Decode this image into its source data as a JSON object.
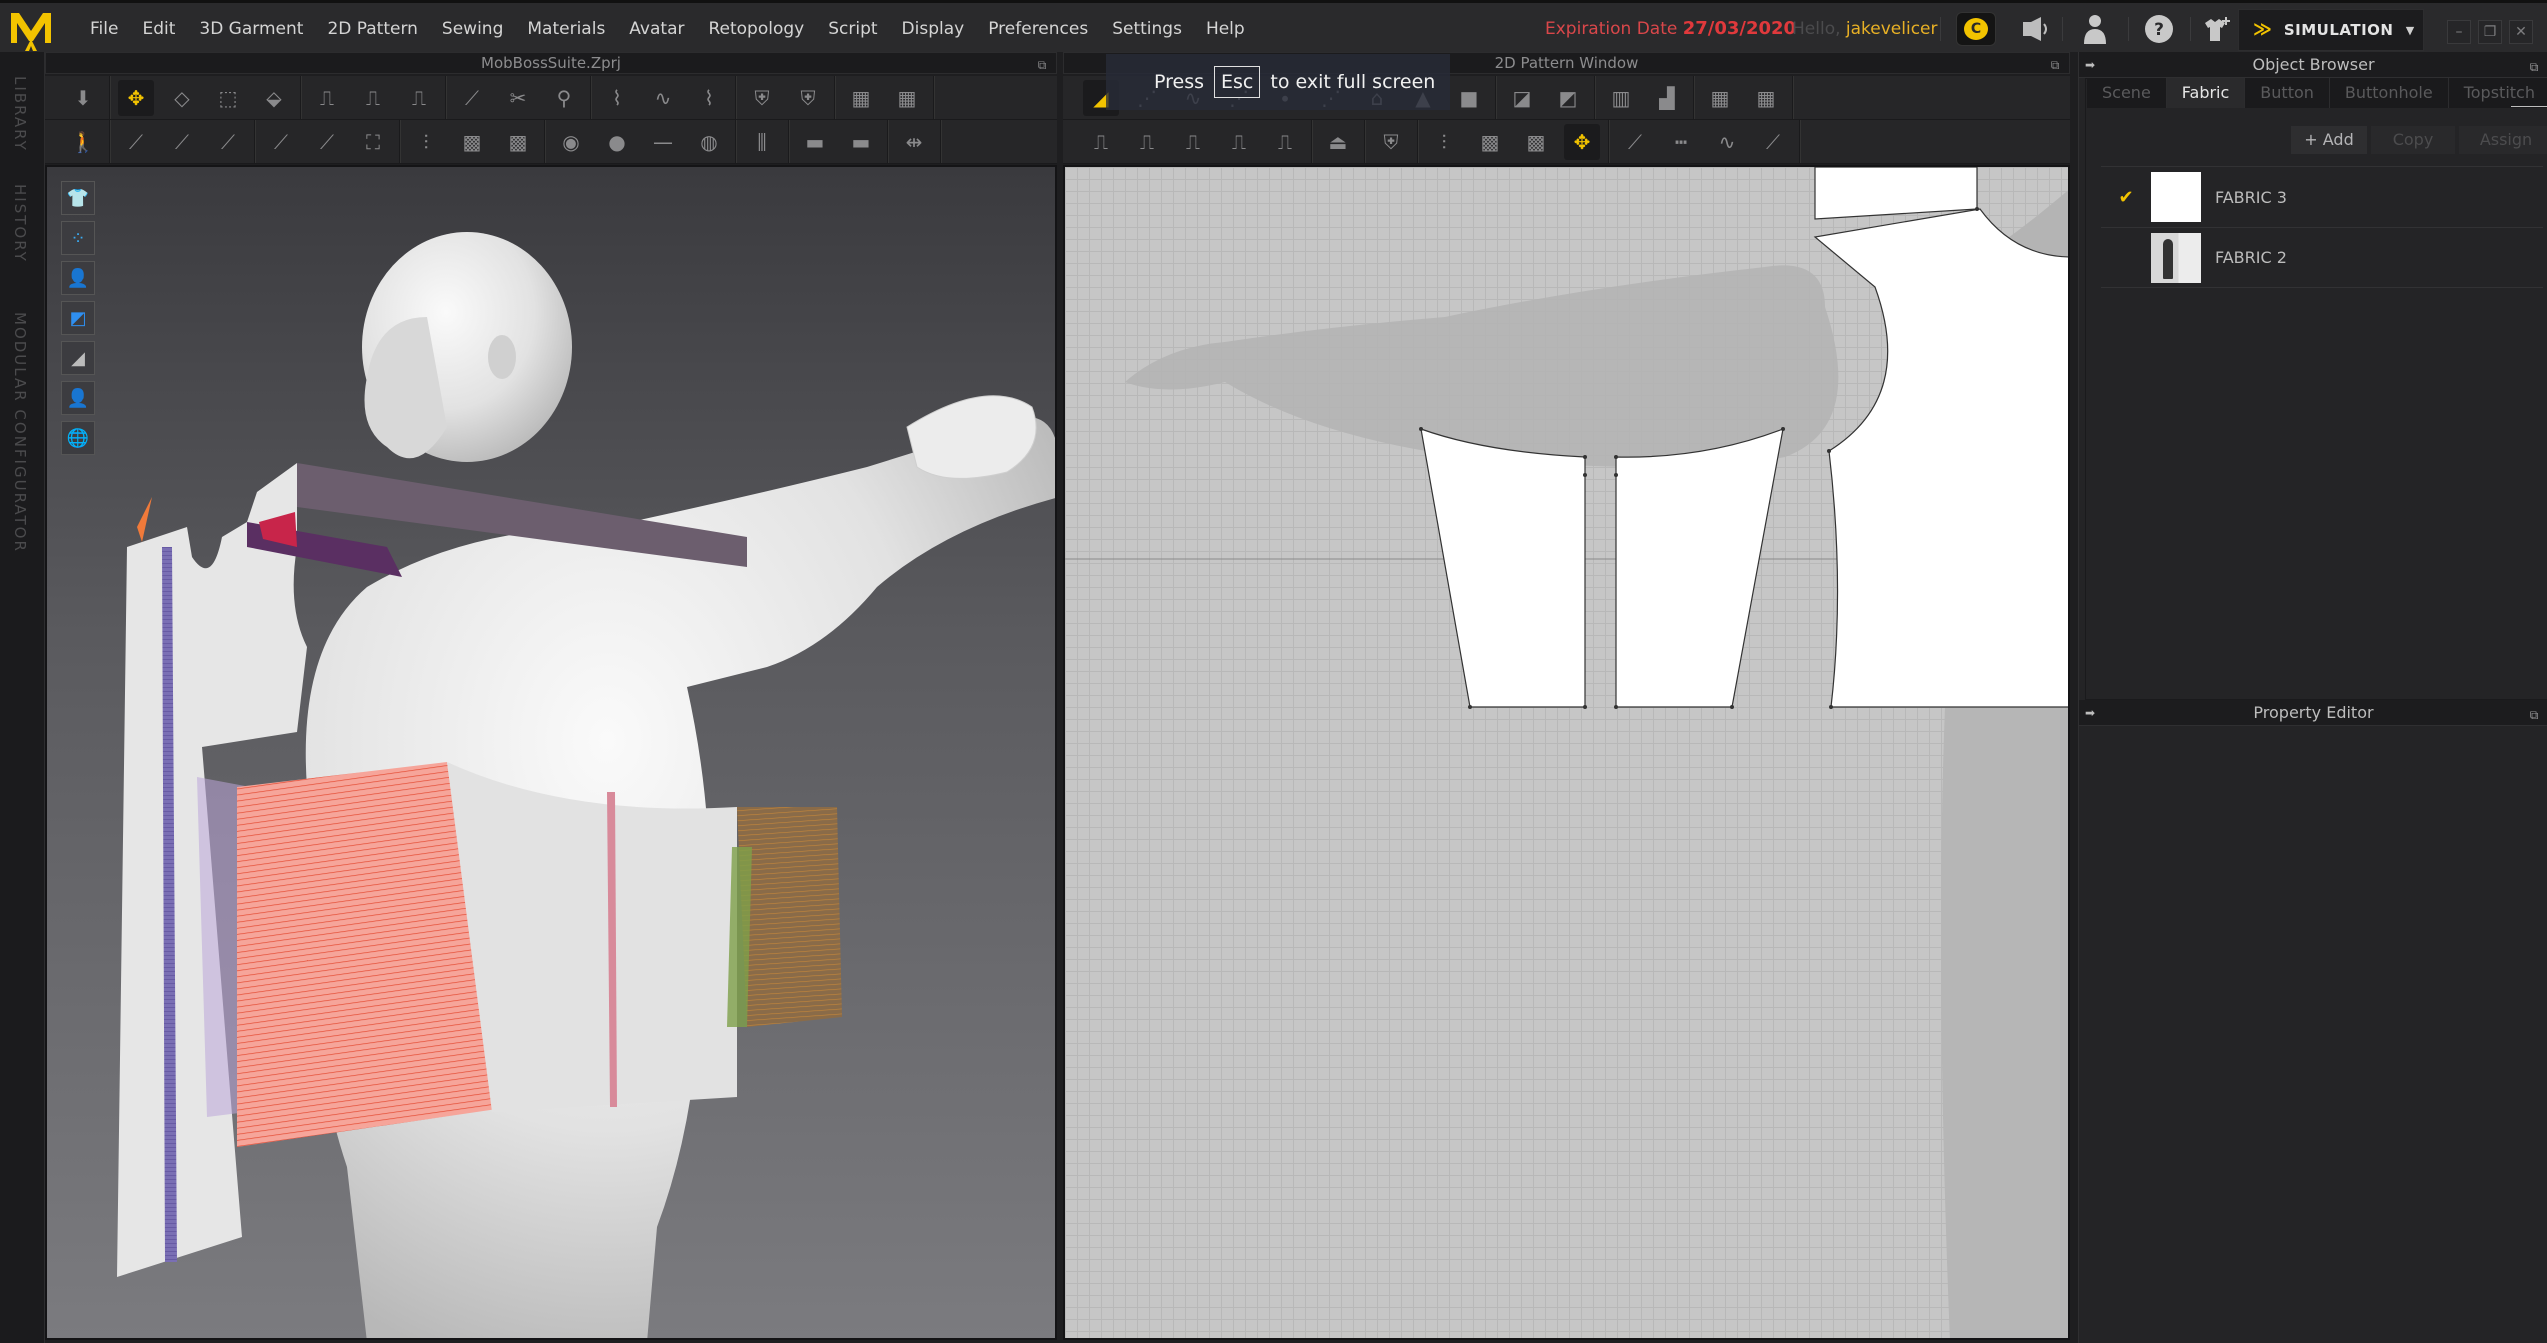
{
  "app": {
    "logo": "marvelous-designer-logo",
    "menu": [
      "File",
      "Edit",
      "3D Garment",
      "2D Pattern",
      "Sewing",
      "Materials",
      "Avatar",
      "Retopology",
      "Script",
      "Display",
      "Preferences",
      "Settings",
      "Help"
    ],
    "expiration_label": "Expiration Date",
    "expiration_date": "27/03/2020",
    "hello_label": "Hello,",
    "username": "jakevelicer",
    "mode_label": "SIMULATION",
    "window_buttons": [
      "–",
      "❐",
      "✕"
    ],
    "accent_color": "#f2c300",
    "expiry_color": "#e0393c"
  },
  "top_icons": [
    "coin-icon",
    "announcement-icon",
    "user-icon",
    "help-icon",
    "add-garment-icon"
  ],
  "left_strip": {
    "labels": [
      "LIBRARY",
      "HISTORY",
      "MODULAR CONFIGURATOR"
    ]
  },
  "pane3d": {
    "title": "MobBossSuite.Zprj",
    "toolbar_row1": [
      [
        "simulation"
      ],
      [
        "select-move",
        "transform-pattern",
        "transform-bounding",
        "fold-arrangement"
      ],
      [
        "segment-sewing",
        "free-sewing",
        "tack"
      ],
      [
        "pin",
        "cut-garment",
        "pin-attach"
      ],
      [
        "draw-3d-line",
        "draw-3d-curve",
        "3d-style-line"
      ],
      [
        "garment-fit-front",
        "garment-fit-back"
      ],
      [
        "select-mesh",
        "edit-mesh"
      ]
    ],
    "toolbar_row2": [
      [
        "avatar-pose"
      ],
      [
        "select-line",
        "edit-line",
        "transform-line"
      ],
      [
        "draw-line",
        "fold",
        "fold-garment"
      ],
      [
        "topstitch",
        "puckering",
        "seamline"
      ],
      [
        "button",
        "buttonhole",
        "line-button",
        "zip-button"
      ],
      [
        "zipper"
      ],
      [
        "fold-tape",
        "elastic-tape"
      ],
      [
        "pin-move"
      ]
    ],
    "viewport_tools": [
      "garment-display-icon",
      "particle-icon",
      "avatar-display-icon",
      "texture-icon",
      "wireframe-icon",
      "avatar-skin-icon",
      "environment-icon"
    ]
  },
  "pane2d": {
    "title": "2D Pattern Window",
    "toast_press": "Press",
    "toast_key": "Esc",
    "toast_rest": "to exit full screen",
    "toolbar_row1": [
      [
        "edit-pattern",
        "edit-point",
        "edit-curve",
        "curve-point",
        "add-point",
        "offset",
        "trace",
        "polygon",
        "rectangle"
      ],
      [
        "internal-polygon",
        "internal-rectangle"
      ],
      [
        "symmetric",
        "unfold"
      ],
      [
        "select-mesh-2d",
        "edit-mesh-2d"
      ]
    ],
    "toolbar_row2": [
      [
        "segment-sewing-2d",
        "free-sewing-2d",
        "tack-2d",
        "check-sewing",
        "find-sewing"
      ],
      [
        "ironing"
      ],
      [
        "pattern-fold"
      ],
      [
        "topstitch-2d",
        "puckering-2d",
        "seamline-2d",
        "edit-texture"
      ],
      [
        "line-2d",
        "dashed-line",
        "curve-line",
        "show-line"
      ]
    ]
  },
  "object_browser": {
    "title": "Object Browser",
    "tabs": [
      "Scene",
      "Fabric",
      "Button",
      "Buttonhole",
      "Topstitch"
    ],
    "active_tab": "Fabric",
    "add_label": "+ Add",
    "copy_label": "Copy",
    "assign_label": "Assign",
    "fabrics": [
      {
        "name": "FABRIC 3",
        "selected": true,
        "thumb": "white"
      },
      {
        "name": "FABRIC 2",
        "selected": false,
        "thumb": "suit-image"
      }
    ]
  },
  "property_editor": {
    "title": "Property Editor"
  }
}
